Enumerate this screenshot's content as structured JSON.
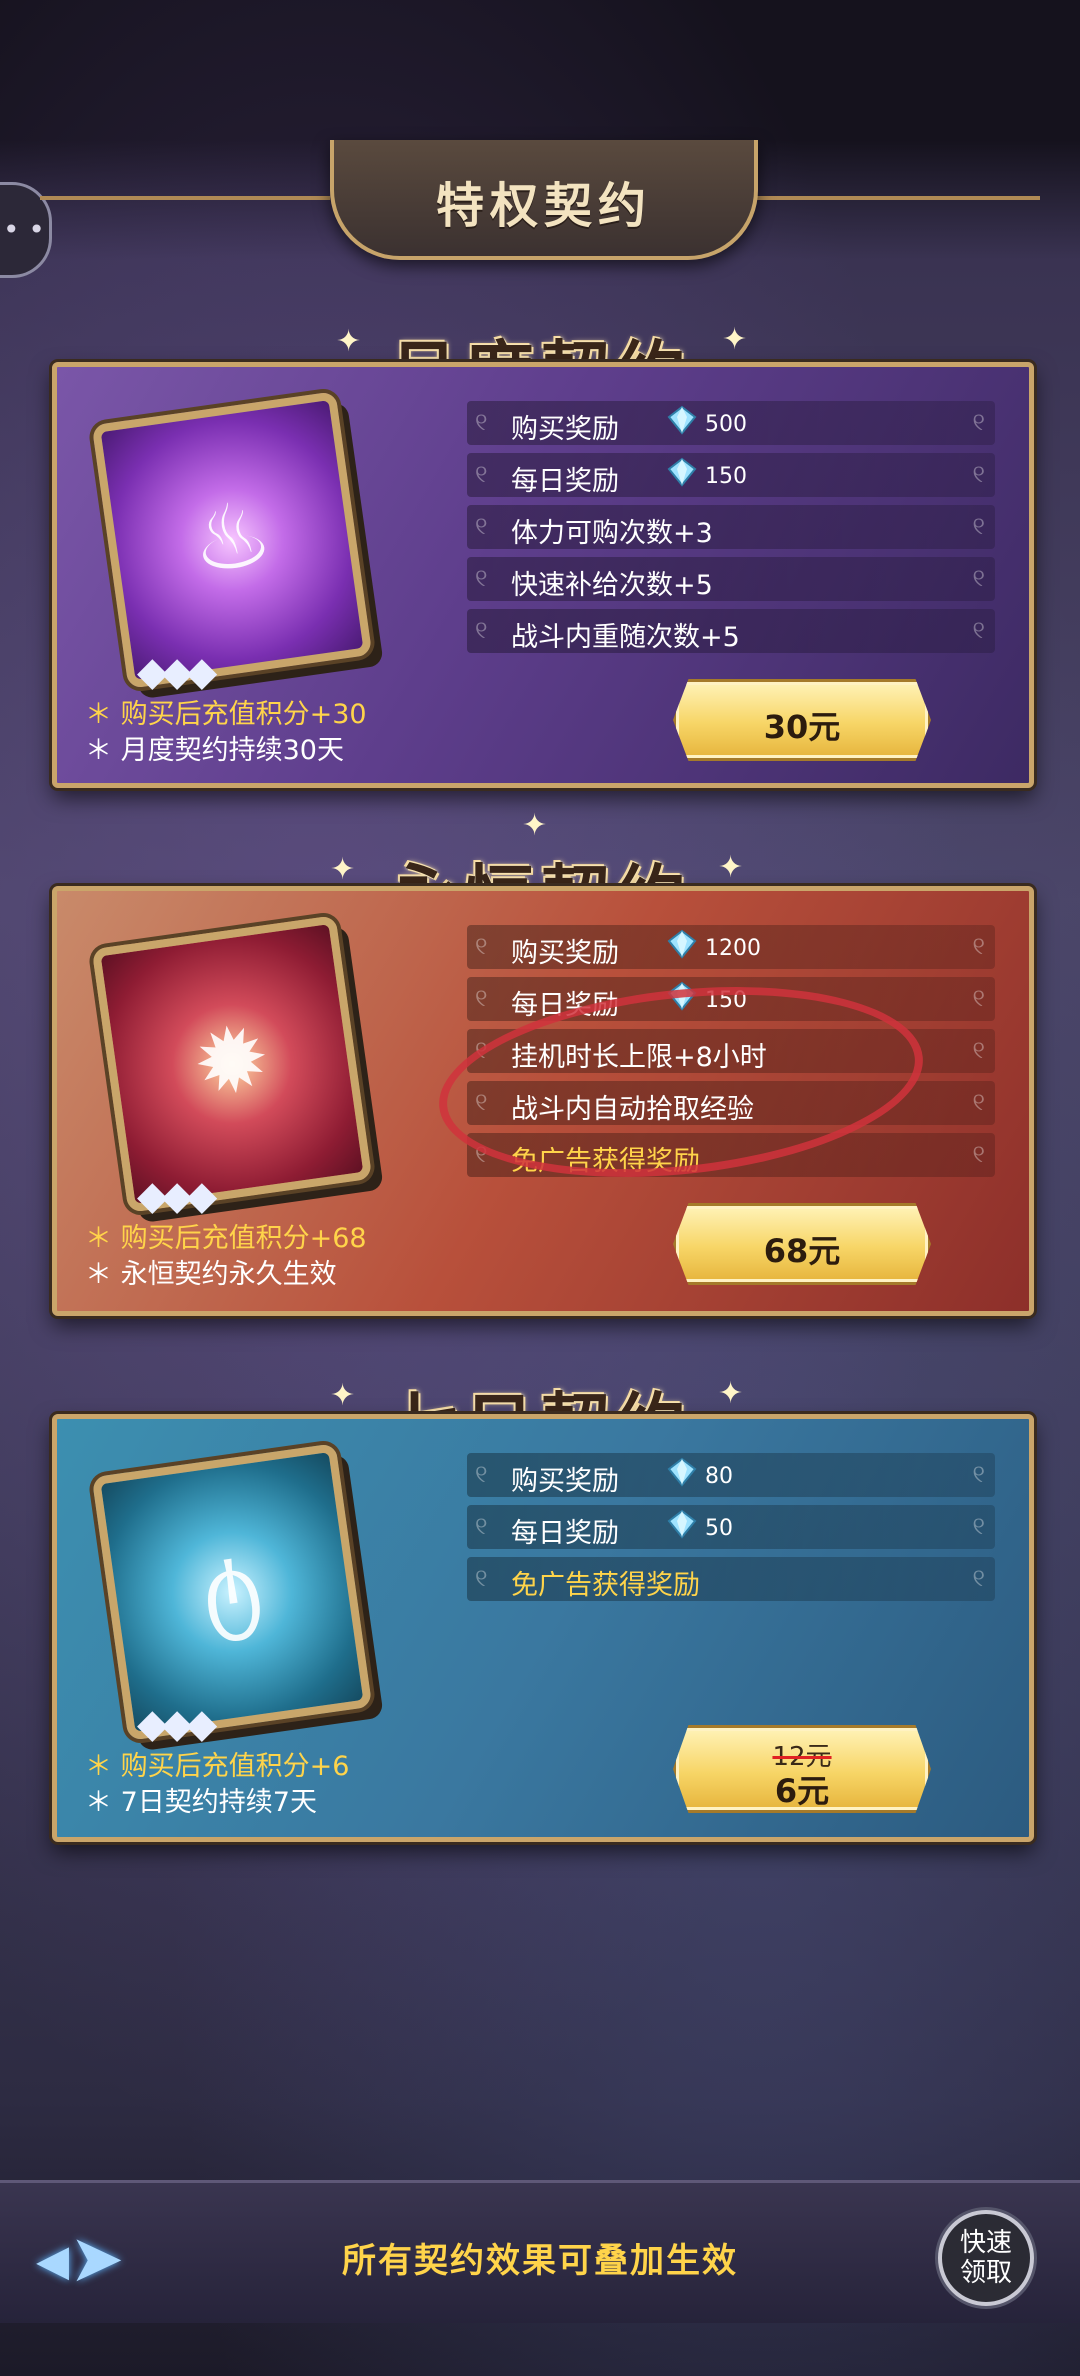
{
  "header": {
    "title": "特权契约"
  },
  "monthly": {
    "title": "月度契约",
    "rows": [
      {
        "label": "购买奖励",
        "amount": "500",
        "icon": "diamond-icon"
      },
      {
        "label": "每日奖励",
        "amount": "150",
        "icon": "diamond-icon"
      },
      {
        "label": "体力可购次数+3"
      },
      {
        "label": "快速补给次数+5"
      },
      {
        "label": "战斗内重随次数+5"
      }
    ],
    "note1": "购买后充值积分+30",
    "note2": "月度契约持续30天",
    "price": "30元"
  },
  "eternal": {
    "title": "永恒契约",
    "rows": [
      {
        "label": "购买奖励",
        "amount": "1200",
        "icon": "diamond-icon"
      },
      {
        "label": "每日奖励",
        "amount": "150",
        "icon": "diamond-icon"
      },
      {
        "label": "挂机时长上限+8小时"
      },
      {
        "label": "战斗内自动拾取经验"
      },
      {
        "label": "免广告获得奖励"
      }
    ],
    "note1": "购买后充值积分+68",
    "note2": "永恒契约永久生效",
    "price": "68元"
  },
  "weekly": {
    "title": "七日契约",
    "rows": [
      {
        "label": "购买奖励",
        "amount": "80",
        "icon": "diamond-icon"
      },
      {
        "label": "每日奖励",
        "amount": "50",
        "icon": "diamond-icon"
      },
      {
        "label": "免广告获得奖励"
      }
    ],
    "note1": "购买后充值积分+6",
    "note2": "7日契约持续7天",
    "old_price": "12元",
    "price": "6元"
  },
  "footer": {
    "message": "所有契约效果可叠加生效",
    "quick_line1": "快速",
    "quick_line2": "领取"
  },
  "colors": {
    "gold_text": "#ffd44a",
    "frame": "#caa56a",
    "annotation": "#d0333c"
  }
}
